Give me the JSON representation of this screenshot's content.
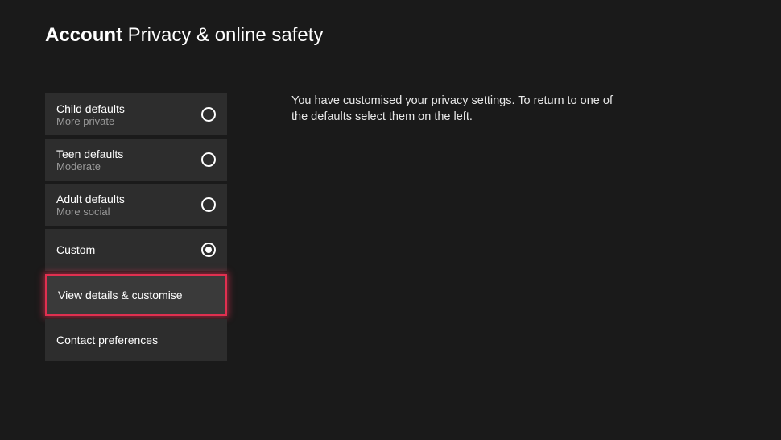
{
  "header": {
    "title_bold": "Account",
    "title_rest": "Privacy & online safety"
  },
  "options": [
    {
      "label": "Child defaults",
      "sublabel": "More private",
      "selected": false
    },
    {
      "label": "Teen defaults",
      "sublabel": "Moderate",
      "selected": false
    },
    {
      "label": "Adult defaults",
      "sublabel": "More social",
      "selected": false
    },
    {
      "label": "Custom",
      "sublabel": "",
      "selected": true
    }
  ],
  "buttons": {
    "view_details": "View details & customise",
    "contact_prefs": "Contact preferences"
  },
  "description": "You have customised your privacy settings. To return to one of the defaults select them on the left."
}
